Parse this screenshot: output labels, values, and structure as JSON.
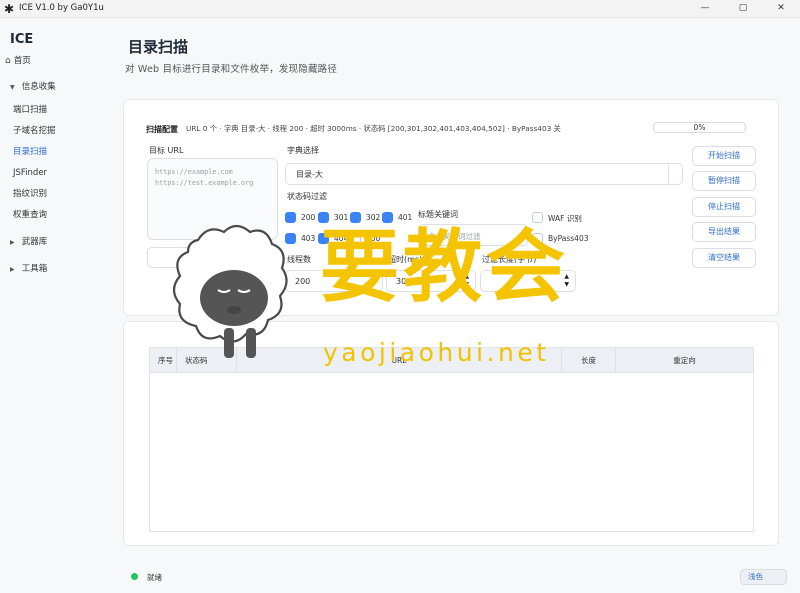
{
  "window": {
    "title": "ICE V1.0 by Ga0Y1u",
    "controls": {
      "minimize": "—",
      "maximize": "▢",
      "close": "✕"
    }
  },
  "sidebar": {
    "brand": "ICE",
    "home": "首页",
    "groups": [
      {
        "label": "信息收集",
        "expanded": true,
        "items": [
          "端口扫描",
          "子域名挖掘",
          "目录扫描",
          "JSFinder",
          "指纹识别",
          "权重查询"
        ]
      },
      {
        "label": "武器库",
        "expanded": false
      },
      {
        "label": "工具箱",
        "expanded": false
      }
    ],
    "active_item": "目录扫描"
  },
  "page": {
    "title": "目录扫描",
    "subtitle": "对 Web 目标进行目录和文件枚举，发现隐藏路径"
  },
  "config": {
    "label": "扫描配置",
    "summary": "URL 0 个 · 字典 目录-大 · 线程 200 · 超时 3000ms · 状态码 [200,301,302,401,403,404,502] · ByPass403 关",
    "progress_text": "0%",
    "progress_value": 0,
    "target_label": "目标 URL",
    "target_placeholder_1": "https://example.com",
    "target_placeholder_2": "https://test.example.org",
    "import_btn": "导入 URL",
    "dict_label": "字典选择",
    "dict_value": "目录-大",
    "status_filter_label": "状态码过滤",
    "status_codes": [
      {
        "code": "200",
        "checked": true
      },
      {
        "code": "301",
        "checked": true
      },
      {
        "code": "302",
        "checked": true
      },
      {
        "code": "401",
        "checked": true
      },
      {
        "code": "403",
        "checked": true
      },
      {
        "code": "404",
        "checked": true
      },
      {
        "code": "500",
        "checked": false
      }
    ],
    "keyword_label": "标题关键词",
    "keyword_placeholder": "含…关键词过滤",
    "waf_label": "WAF 识别",
    "bypass_label": "ByPass403",
    "threads_label": "线程数",
    "threads_value": "200",
    "timeout_label": "超时(ms)",
    "timeout_value": "3000",
    "length_label": "过滤长度(字节)"
  },
  "actions": {
    "start": "开始扫描",
    "pause": "暂停扫描",
    "stop": "停止扫描",
    "export": "导出结果",
    "clear": "清空结果"
  },
  "table": {
    "columns": [
      "序号",
      "状态码",
      "URL",
      "长度",
      "重定向"
    ]
  },
  "status": {
    "text": "就绪",
    "theme_btn": "浅色"
  },
  "watermark": {
    "cn": "要教会",
    "url": "yaojiaohui.net"
  },
  "colors": {
    "accent": "#2f6fd1",
    "checkbox": "#3b82f6",
    "status_dot": "#22c55e",
    "watermark": "#f5c400"
  }
}
